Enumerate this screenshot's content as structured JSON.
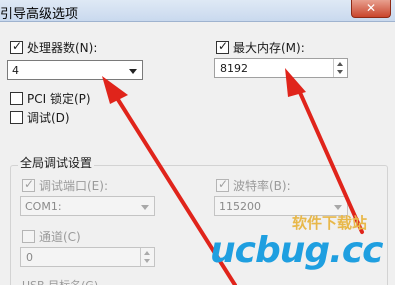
{
  "window": {
    "title": "引导高级选项",
    "close_glyph": "✕"
  },
  "processor": {
    "label": "处理器数(N):",
    "checked": true,
    "value": "4"
  },
  "max_memory": {
    "label": "最大内存(M):",
    "checked": true,
    "value": "8192"
  },
  "pci_lock": {
    "label": "PCI 锁定(P)",
    "checked": false
  },
  "debug": {
    "label": "调试(D)",
    "checked": false
  },
  "global_debug": {
    "title": "全局调试设置",
    "port": {
      "label": "调试端口(E):",
      "checked": true,
      "value": "COM1:"
    },
    "baud": {
      "label": "波特率(B):",
      "checked": true,
      "value": "115200"
    },
    "channel": {
      "label": "通道(C)",
      "checked": false,
      "value": "0"
    },
    "usb_label": "USB 目标名(G)"
  },
  "watermark": {
    "text_cn": "软件下载站",
    "logo": "ucbug.cc"
  },
  "colors": {
    "arrow": "#e0241b",
    "logo_blue": "#1f9fe0",
    "logo_gold": "#e8b84a"
  }
}
